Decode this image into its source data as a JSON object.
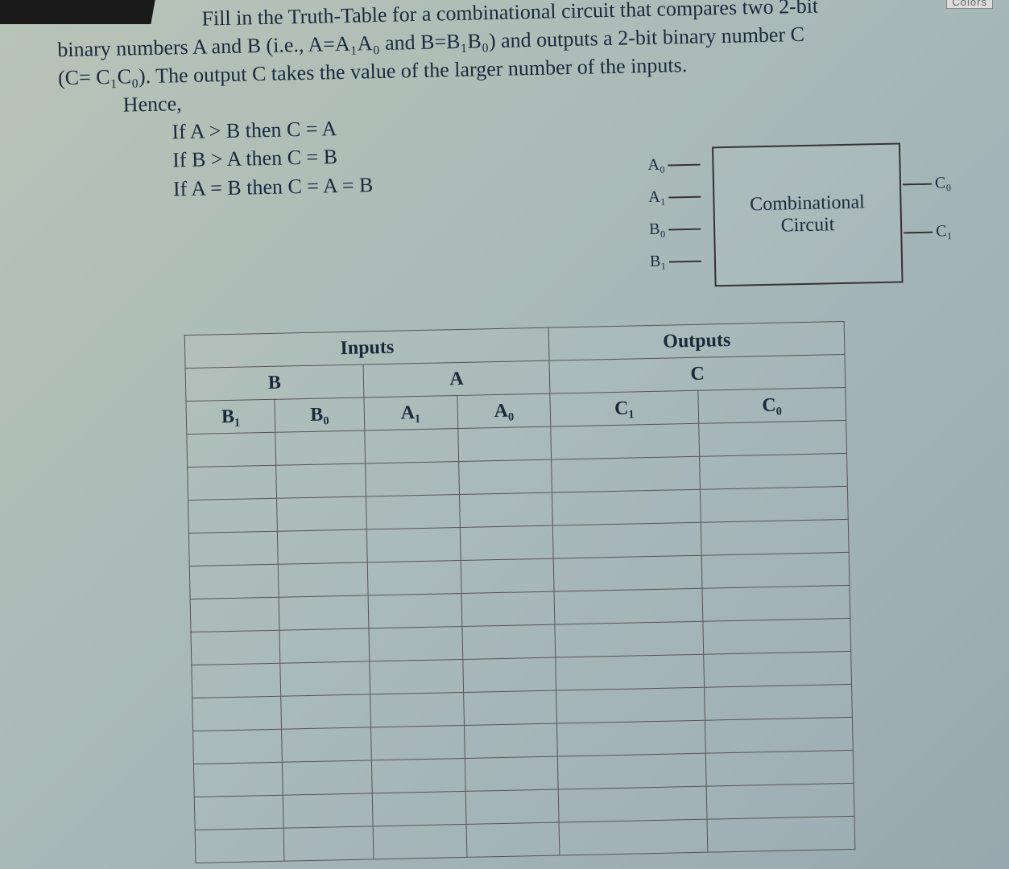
{
  "top_label": "Colors",
  "problem": {
    "line1_a": "Fill in the Truth-Table for a combinational circuit that compares two 2-bit",
    "line2": "binary numbers A and B (i.e., A=A₁A₀ and B=B₁B₀) and outputs a 2-bit binary number C",
    "line3": "(C= C₁C₀). The output C takes the value of the larger number of the inputs.",
    "line4": "Hence,",
    "cond1": "If A > B then C = A",
    "cond2": "If B > A then C = B",
    "cond3": "If A = B then C = A = B"
  },
  "diagram": {
    "block_line1": "Combinational",
    "block_line2": "Circuit",
    "in": [
      "A₀",
      "A₁",
      "B₀",
      "B₁"
    ],
    "out": [
      "C₀",
      "C₁"
    ]
  },
  "table": {
    "top": {
      "inputs": "Inputs",
      "outputs": "Outputs"
    },
    "mid": {
      "B": "B",
      "A": "A",
      "C": "C"
    },
    "cols": [
      "B₁",
      "B₀",
      "A₁",
      "A₀",
      "C₁",
      "C₀"
    ],
    "body_row_count": 13
  }
}
